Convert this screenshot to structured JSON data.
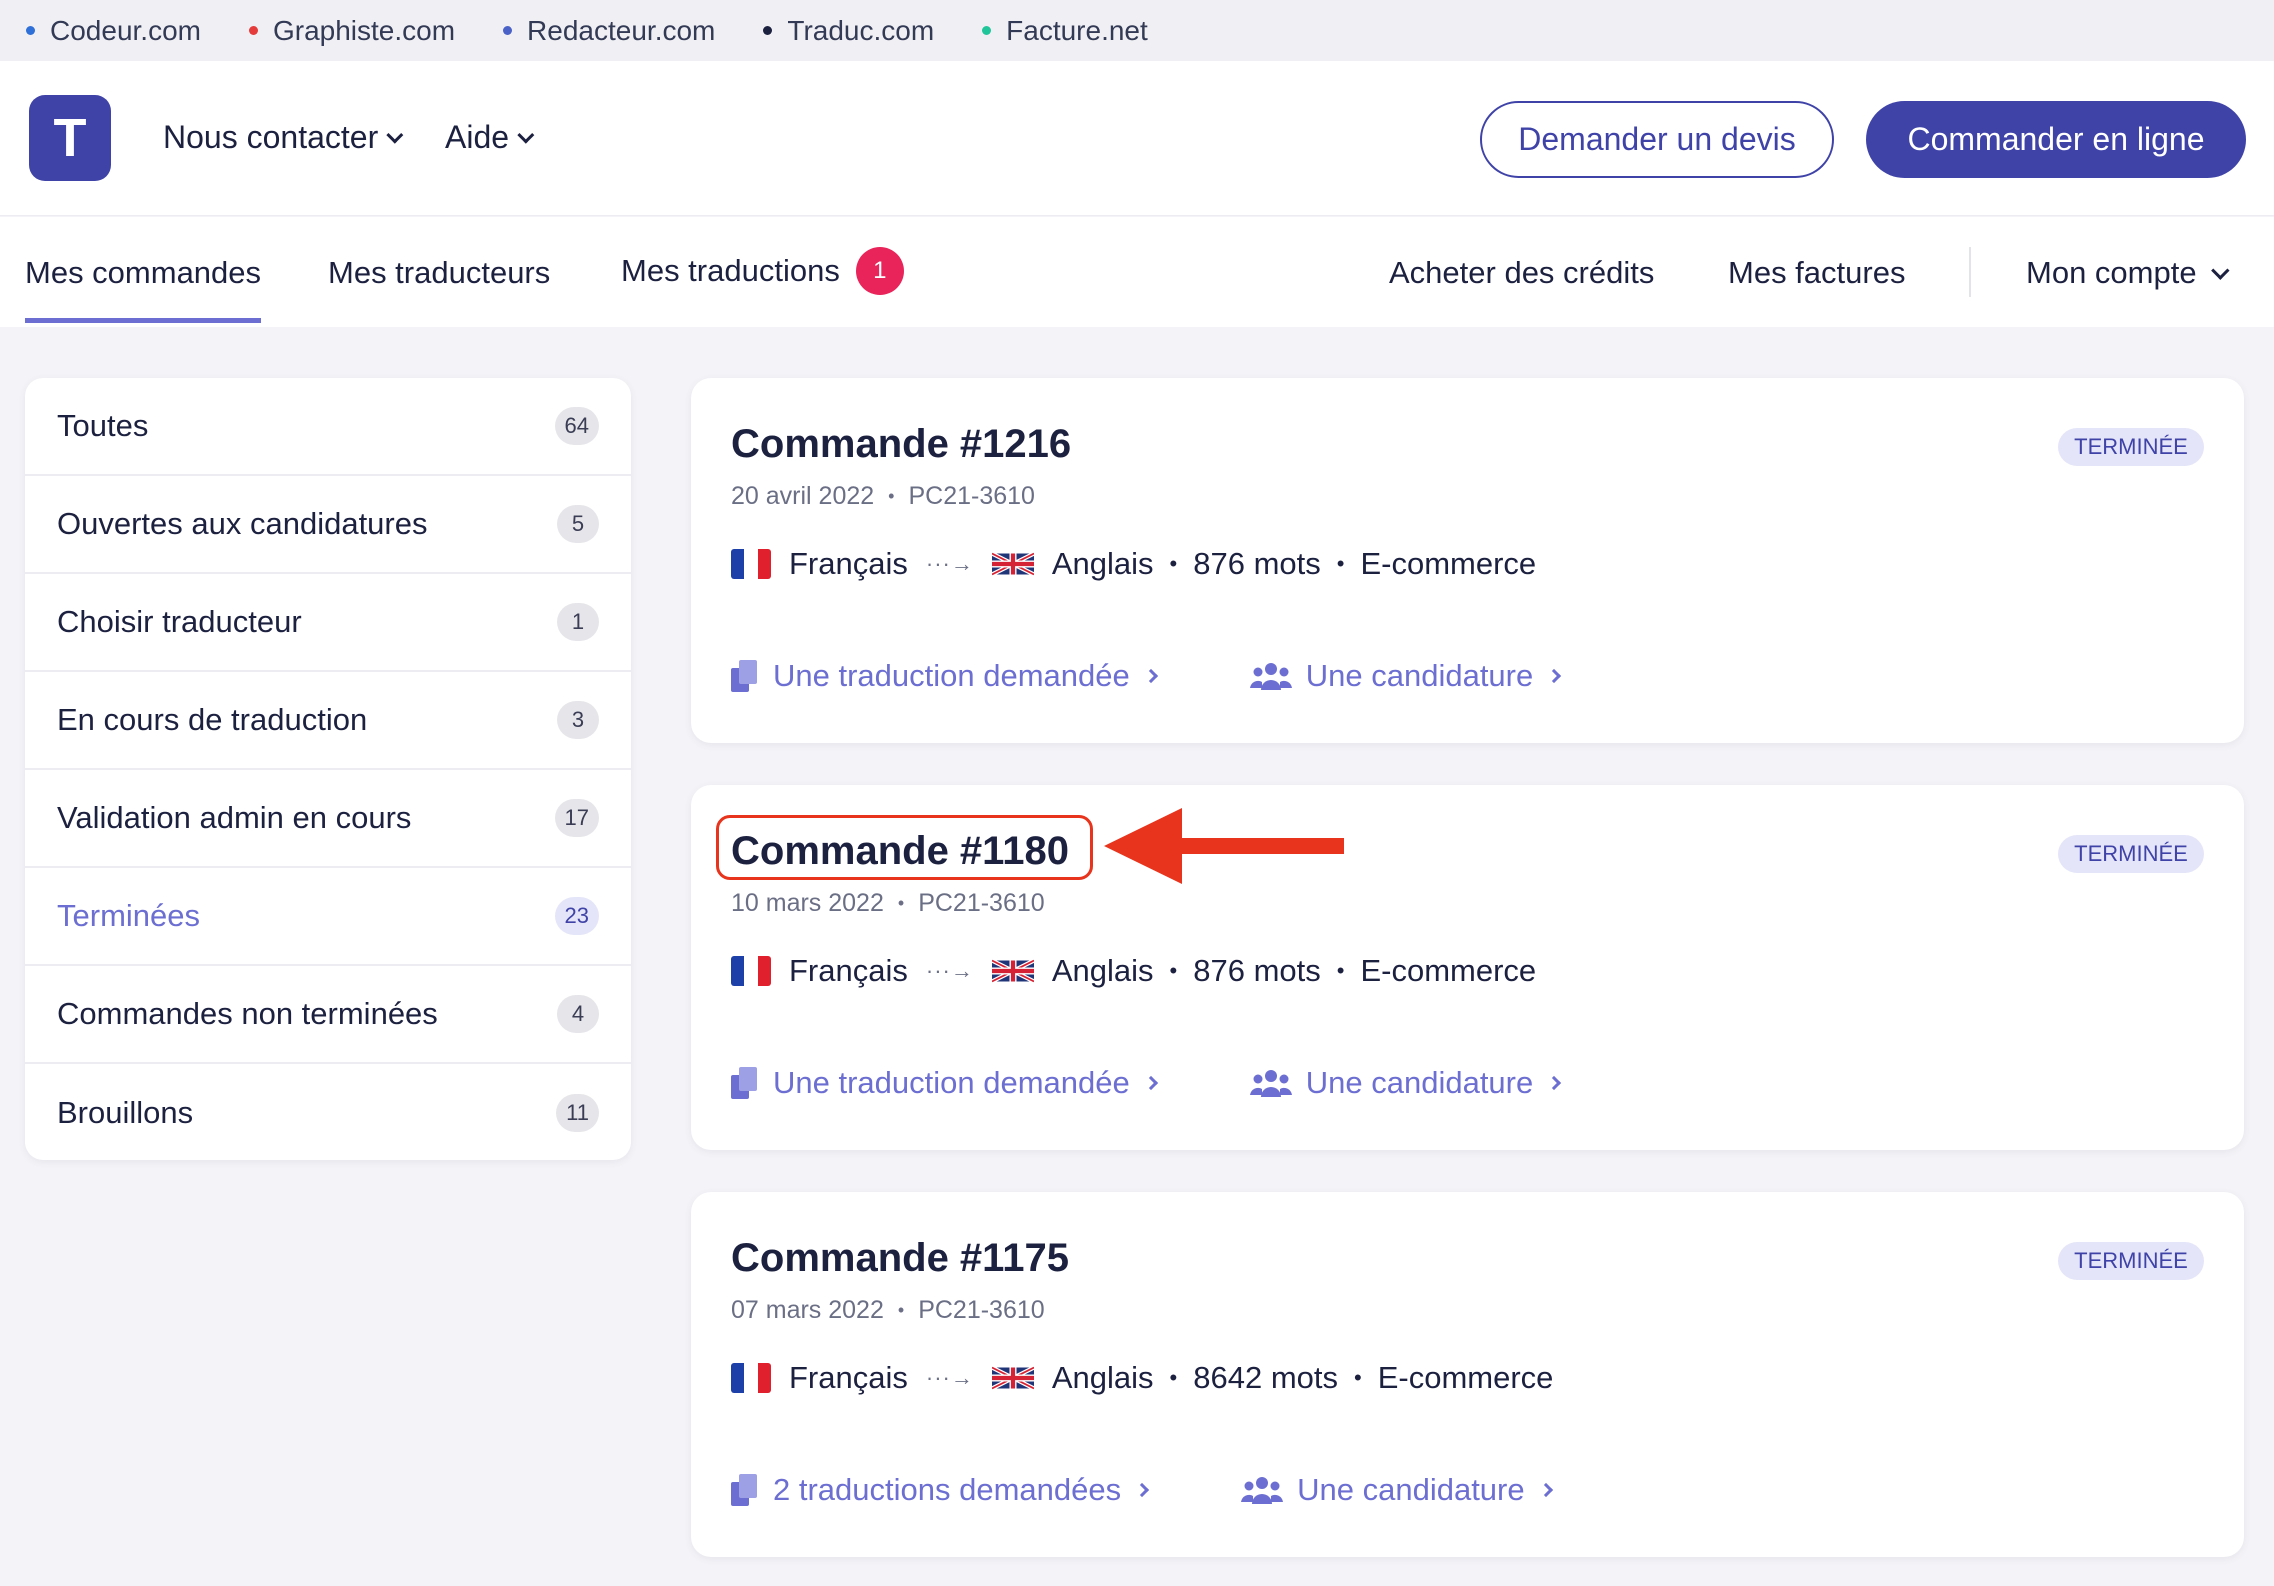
{
  "network": {
    "sites": [
      {
        "label": "Codeur.com",
        "color": "#2e6fd8"
      },
      {
        "label": "Graphiste.com",
        "color": "#e53b3b"
      },
      {
        "label": "Redacteur.com",
        "color": "#4a62c8"
      },
      {
        "label": "Traduc.com",
        "color": "#1d2140"
      },
      {
        "label": "Facture.net",
        "color": "#21c59a"
      }
    ]
  },
  "header": {
    "logo_letter": "T",
    "nav": [
      "Nous contacter",
      "Aide"
    ],
    "quote_button": "Demander un devis",
    "order_button": "Commander en ligne"
  },
  "tabs": {
    "left": [
      "Mes commandes",
      "Mes traducteurs",
      "Mes traductions"
    ],
    "notification_count": "1",
    "right": [
      "Acheter des crédits",
      "Mes factures",
      "Mon compte"
    ]
  },
  "sidebar": {
    "items": [
      {
        "label": "Toutes",
        "count": "64"
      },
      {
        "label": "Ouvertes aux candidatures",
        "count": "5"
      },
      {
        "label": "Choisir traducteur",
        "count": "1"
      },
      {
        "label": "En cours de traduction",
        "count": "3"
      },
      {
        "label": "Validation admin en cours",
        "count": "17"
      },
      {
        "label": "Terminées",
        "count": "23"
      },
      {
        "label": "Commandes non terminées",
        "count": "4"
      },
      {
        "label": "Brouillons",
        "count": "11"
      }
    ]
  },
  "orders": [
    {
      "title": "Commande #1216",
      "date": "20 avril 2022",
      "ref": "PC21-3610",
      "status": "TERMINÉE",
      "source_lang": "Français",
      "target_lang": "Anglais",
      "words": "876 mots",
      "category": "E-commerce",
      "translations_link": "Une traduction demandée",
      "applications_link": "Une candidature"
    },
    {
      "title": "Commande #1180",
      "date": "10 mars 2022",
      "ref": "PC21-3610",
      "status": "TERMINÉE",
      "source_lang": "Français",
      "target_lang": "Anglais",
      "words": "876 mots",
      "category": "E-commerce",
      "translations_link": "Une traduction demandée",
      "applications_link": "Une candidature"
    },
    {
      "title": "Commande #1175",
      "date": "07 mars 2022",
      "ref": "PC21-3610",
      "status": "TERMINÉE",
      "source_lang": "Français",
      "target_lang": "Anglais",
      "words": "8642 mots",
      "category": "E-commerce",
      "translations_link": "2 traductions demandées",
      "applications_link": "Une candidature"
    }
  ],
  "colors": {
    "accent": "#3f43a8",
    "link": "#6c6fd1",
    "notification": "#e8245a",
    "annotation": "#e8341c"
  }
}
